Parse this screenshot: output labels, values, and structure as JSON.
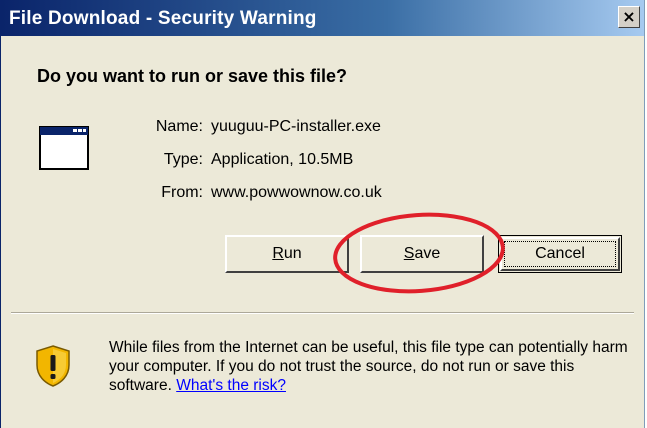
{
  "window": {
    "title": "File Download - Security Warning",
    "close_glyph": "×"
  },
  "heading": "Do you want to run or save this file?",
  "file_icon": "application-window-icon",
  "fields": {
    "name_label": "Name:",
    "name_value": "yuuguu-PC-installer.exe",
    "type_label": "Type:",
    "type_value": "Application, 10.5MB",
    "from_label": "From:",
    "from_value": "www.powwownow.co.uk"
  },
  "buttons": {
    "run_key": "R",
    "run_rest": "un",
    "save_key": "S",
    "save_rest": "ave",
    "cancel_label": "Cancel"
  },
  "warning": {
    "icon": "shield-warning-icon",
    "text": "While files from the Internet can be useful, this file type can potentially harm your computer. If you do not trust the source, do not run or save this software.",
    "link": "What's the risk?"
  },
  "annotation": {
    "color": "#e0202a"
  },
  "colors": {
    "dialog_bg": "#ece9d8",
    "title_bar": "#0a246a",
    "link": "#0000ff"
  }
}
